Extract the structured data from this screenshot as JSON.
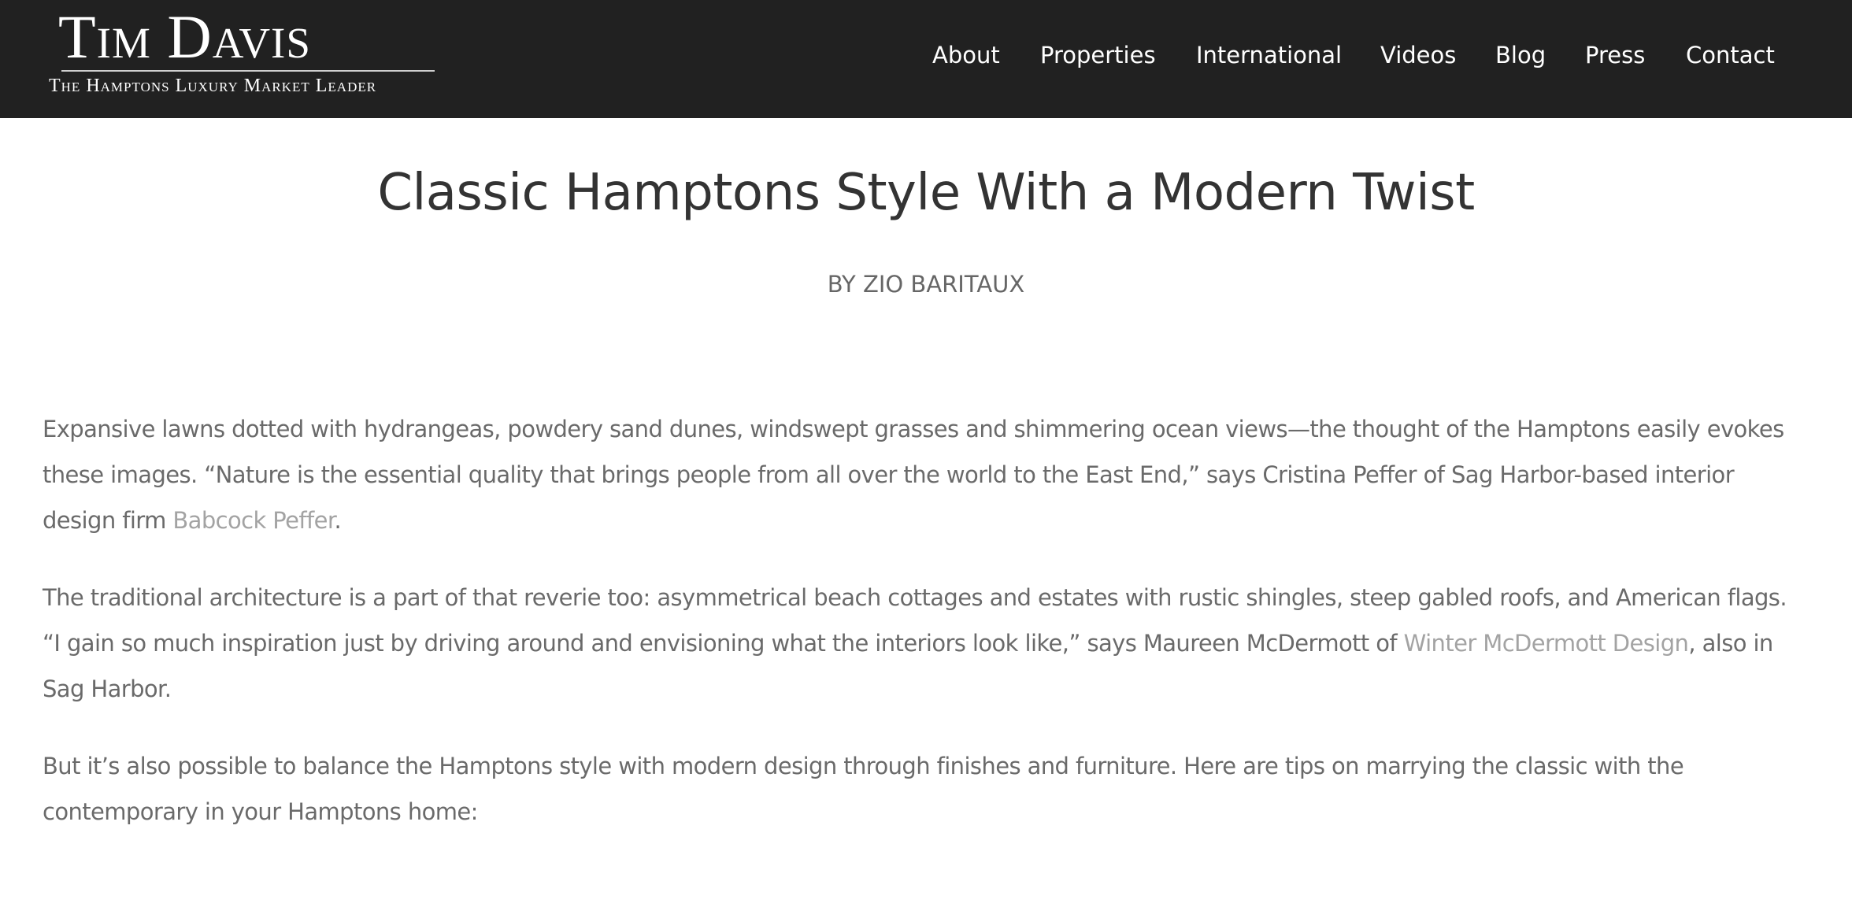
{
  "header": {
    "logo_name": "Tim Davis",
    "logo_tagline": "The Hamptons Luxury Market Leader",
    "background_color": "#212121",
    "nav": [
      "About",
      "Properties",
      "International",
      "Videos",
      "Blog",
      "Press",
      "Contact"
    ]
  },
  "article": {
    "title": "Classic Hamptons Style With a Modern Twist",
    "byline": "BY ZIO BARITAUX",
    "p1": {
      "text_before": "Expansive lawns dotted with hydrangeas, powdery sand dunes, windswept grasses and shimmering ocean views—the thought of the Hamptons easily evokes these images. “Nature is the essential quality that brings people from all over the world to the East End,” says Cristina Peffer of Sag Harbor-based interior design firm ",
      "link": "Babcock Peffer",
      "text_after": "."
    },
    "p2": {
      "text_before": "The traditional architecture is a part of that reverie too: asymmetrical beach cottages and estates with rustic shingles, steep gabled roofs, and American flags. “I gain so much inspiration just by driving around and envisioning what the interiors look like,” says Maureen McDermott of ",
      "link": "Winter McDermott Design",
      "text_after": ", also in Sag Harbor."
    },
    "p3": "But it’s also possible to balance the Hamptons style with modern design through finishes and furniture. Here are tips on marrying the classic with the contemporary in your Hamptons home:"
  },
  "colors": {
    "text": "#6a6a6a",
    "title": "#333333",
    "link": "#a3a3a3"
  }
}
